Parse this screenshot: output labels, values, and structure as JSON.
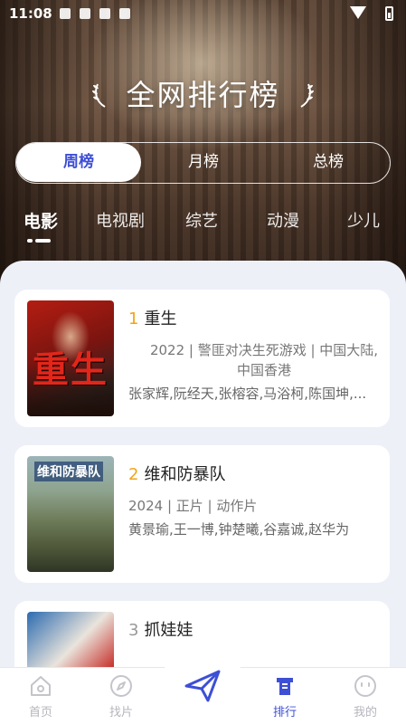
{
  "status_bar": {
    "time": "11:08"
  },
  "header": {
    "title": "全网排行榜"
  },
  "period_tabs": [
    {
      "label": "周榜",
      "active": true
    },
    {
      "label": "月榜",
      "active": false
    },
    {
      "label": "总榜",
      "active": false
    }
  ],
  "categories": [
    {
      "label": "电影",
      "active": true
    },
    {
      "label": "电视剧",
      "active": false
    },
    {
      "label": "综艺",
      "active": false
    },
    {
      "label": "动漫",
      "active": false
    },
    {
      "label": "少儿",
      "active": false
    }
  ],
  "movies": [
    {
      "rank": "1",
      "title": "重生",
      "meta": "2022 | 警匪对决生死游戏 | 中国大陆,中国香港",
      "cast": "张家辉,阮经天,张榕容,马浴柯,陈国坤,...",
      "poster_text": "重生"
    },
    {
      "rank": "2",
      "title": "维和防暴队",
      "meta": "2024 | 正片 | 动作片",
      "cast": "黄景瑜,王一博,钟楚曦,谷嘉诚,赵华为",
      "poster_text": "维和防暴队"
    },
    {
      "rank": "3",
      "title": "抓娃娃",
      "meta": "",
      "cast": ""
    }
  ],
  "bottom_nav": [
    {
      "label": "首页",
      "icon": "home-icon",
      "active": false
    },
    {
      "label": "找片",
      "icon": "compass-icon",
      "active": false
    },
    {
      "label": "",
      "icon": "paper-plane-icon",
      "active": false
    },
    {
      "label": "排行",
      "icon": "ranking-icon",
      "active": true
    },
    {
      "label": "我的",
      "icon": "smiley-icon",
      "active": false
    }
  ],
  "colors": {
    "accent": "#3d4fd6",
    "rank_gold": "#f2a514",
    "panel_bg": "#eef0f8"
  }
}
